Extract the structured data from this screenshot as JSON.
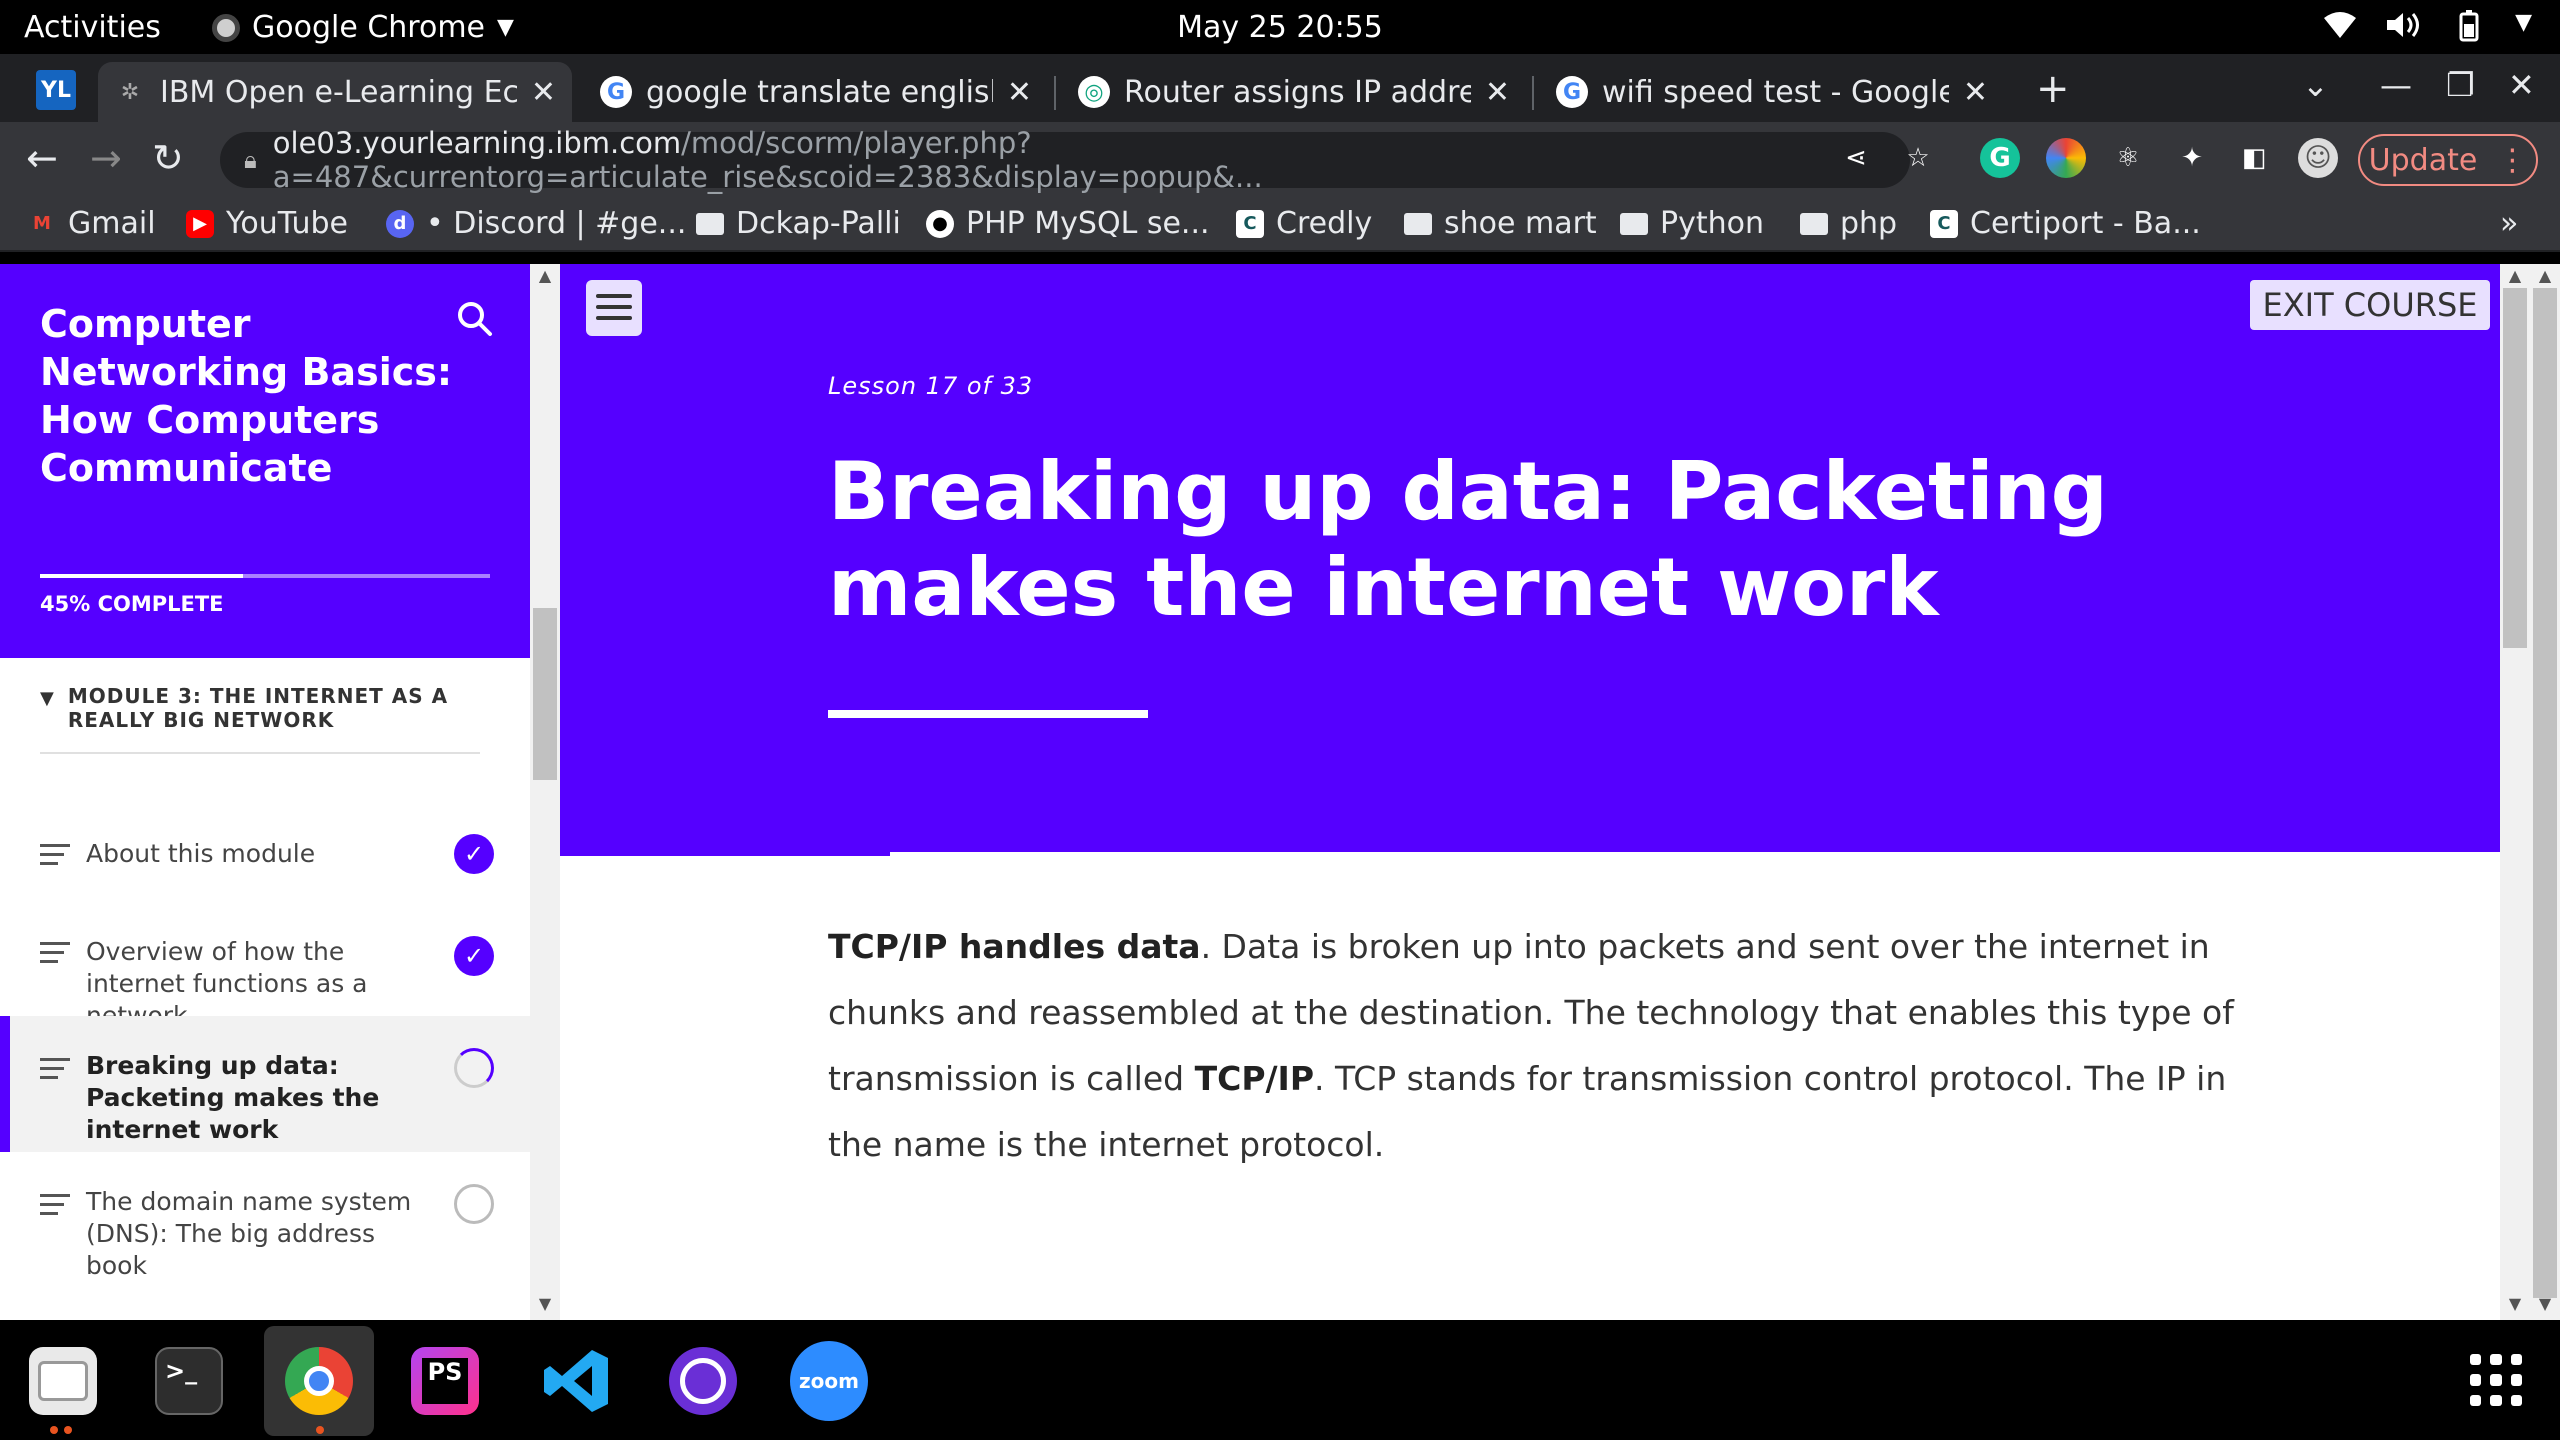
{
  "topbar": {
    "activities": "Activities",
    "app_name": "Google Chrome",
    "clock": "May 25  20:55"
  },
  "tabs": [
    {
      "label": "IBM Open e-Learning Eco",
      "icon": "ibm-tab-icon",
      "active": true
    },
    {
      "label": "google translate english t",
      "icon": "google-icon"
    },
    {
      "label": "Router assigns IP address",
      "icon": "chatgpt-icon"
    },
    {
      "label": "wifi speed test - Google S",
      "icon": "google-icon"
    }
  ],
  "toolbar": {
    "url_host": "ole03.yourlearning.ibm.com",
    "url_path": "/mod/scorm/player.php?a=487&currentorg=articulate_rise&scoid=2383&display=popup&...",
    "update_label": "Update"
  },
  "bookmarks": [
    {
      "label": "Gmail",
      "icon": "gmail-icon"
    },
    {
      "label": "YouTube",
      "icon": "youtube-icon"
    },
    {
      "label": "• Discord | #ge...",
      "icon": "discord-icon"
    },
    {
      "label": "Dckap-Palli",
      "icon": "folder-icon"
    },
    {
      "label": "PHP MySQL se...",
      "icon": "medium-icon"
    },
    {
      "label": "Credly",
      "icon": "credly-icon"
    },
    {
      "label": "shoe mart",
      "icon": "folder-icon"
    },
    {
      "label": "Python",
      "icon": "folder-icon"
    },
    {
      "label": "php",
      "icon": "folder-icon"
    },
    {
      "label": "Certiport - Ba...",
      "icon": "certiport-icon"
    }
  ],
  "sidebar": {
    "course_title": "Computer Networking Basics: How Computers Communicate",
    "progress_label": "45% COMPLETE",
    "progress": 0.45,
    "module_title": "MODULE 3: THE INTERNET AS A REALLY BIG NETWORK",
    "lessons": [
      {
        "label": "About this module",
        "status": "complete"
      },
      {
        "label": "Overview of how the internet functions as a network",
        "status": "complete"
      },
      {
        "label": "Breaking up data: Packeting makes the internet work",
        "status": "in-progress"
      },
      {
        "label": "The domain name system (DNS): The big address book",
        "status": "not-started"
      }
    ]
  },
  "main": {
    "exit_label": "EXIT COURSE",
    "lesson_count": "Lesson 17 of 33",
    "lesson_title": "Breaking up data: Packeting makes the internet work",
    "body": {
      "b1": "TCP/IP handles data",
      "t1": ". Data is broken up into packets and sent over the internet in chunks and reassembled at the destination. The technology that enables this type of transmission is called ",
      "b2": "TCP/IP",
      "t2": ". TCP stands for transmission control protocol. The IP in the name is the internet protocol."
    }
  },
  "colors": {
    "accent": "#5500ff",
    "chrome_dark": "#202124",
    "chrome_toolbar": "#35363a"
  },
  "dock": {
    "zoom_label": "zoom",
    "phpstorm_label": "PS"
  }
}
